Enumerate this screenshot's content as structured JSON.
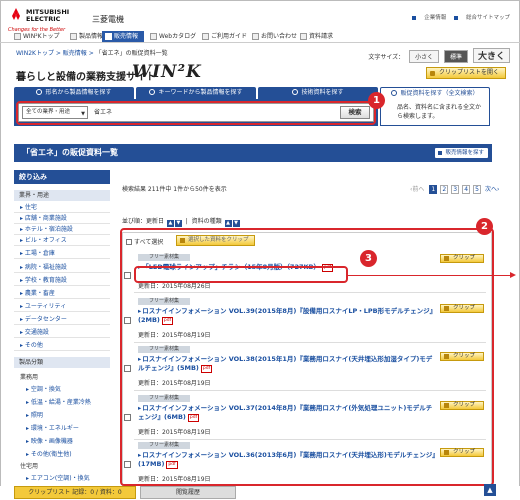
{
  "colors": {
    "primary": "#244f96",
    "annotation_red": "#d9262c",
    "clip_yellow": "#f3c93a",
    "link_blue": "#1a4fa0"
  },
  "header": {
    "logo_brand": "MITSUBISHI ELECTRIC",
    "logo_tagline": "Changes for the Better",
    "site_name": "三菱電機",
    "links": [
      "企業情報",
      "総合サイトマップ"
    ]
  },
  "nav": {
    "tabs": [
      "WIN²Kトップ",
      "製品情報",
      "販売情報",
      "Webカタログ",
      "ご利用ガイド",
      "お問い合わせ",
      "資料請求"
    ],
    "active": "販売情報"
  },
  "breadcrumb": [
    "WIN2Kトップ",
    "販売情報",
    "「省エネ」の販促資料一覧"
  ],
  "font_size": {
    "label": "文字サイズ：",
    "options": [
      "小さく",
      "標準",
      "大きく"
    ],
    "active": "標準"
  },
  "site_title": "暮らしと設備の業務支援サイト",
  "wink_logo": "WIN²K",
  "clip_list_open": "クリップリストを開く",
  "search": {
    "tabs": [
      "形名から製品情報を探す",
      "キーワードから製品情報を探す",
      "技術資料を探す",
      "販促資料を探す（全文検索）"
    ],
    "active_tab": "販促資料を探す（全文検索）",
    "category_select": "全ての業界・用途",
    "keyword": "省エネ",
    "button": "検索",
    "fulltext_note": "品名、資料名に含まれる全文から検索します。"
  },
  "annotations": [
    "1",
    "2",
    "3"
  ],
  "list_header": {
    "title": "「省エネ」の販促資料一覧",
    "sales_info_button": "販売情報を探す"
  },
  "sidebar": {
    "title": "絞り込み",
    "sections": [
      {
        "label": "業界・用途",
        "items": [
          "住宅",
          "店舗・商業施設",
          "ホテル・宿泊施設",
          "ビル・オフィス",
          "工場・倉庫",
          "病院・福祉施設",
          "学校・教育施設",
          "農業・畜産",
          "ユーティリティ",
          "データセンター",
          "交通施設",
          "その他"
        ]
      },
      {
        "label": "製品分類",
        "items": []
      }
    ],
    "subgroups": [
      {
        "label": "業務用",
        "items": [
          "空調・換気",
          "低温・給湯・産業冷熱",
          "照明",
          "環境・エネルギー",
          "映像・画像機器",
          "その他(衛生他)"
        ]
      },
      {
        "label": "住宅用",
        "items": [
          "エアコン(空調)・換気"
        ]
      }
    ]
  },
  "results": {
    "summary": "検索結果 211件中 1件から50件を表示",
    "pager": {
      "prev": "前へ",
      "pages": [
        "1",
        "2",
        "3",
        "4",
        "5"
      ],
      "active": "1",
      "next": "次へ"
    },
    "sort": {
      "label1": "並び順：更新日",
      "label2": "資料の種類"
    },
    "select_all": "すべて選択",
    "clip_selected": "選択した資料をクリップ",
    "items": [
      {
        "category": "フリー素材集",
        "title": "「LED電球ラインアップ」チラシ（15年8月版）（727KB）",
        "date": "更新日：2015年08月26日",
        "clip": "クリップ"
      },
      {
        "category": "フリー素材集",
        "title": "ロスナイインフォメーション VOL.39(2015年8月)『設備用ロスナイLP・LPB形モデルチェンジ』(2MB)",
        "date": "更新日：2015年08月19日",
        "clip": "クリップ"
      },
      {
        "category": "フリー素材集",
        "title": "ロスナイインフォメーション VOL.38(2015年1月)『業務用ロスナイ(天井埋込形加湿タイプ)モデルチェンジ』(5MB)",
        "date": "更新日：2015年08月19日",
        "clip": "クリップ"
      },
      {
        "category": "フリー素材集",
        "title": "ロスナイインフォメーション VOL.37(2014年8月)『業務用ロスナイ(外気処理ユニット)モデルチェンジ』(6MB)",
        "date": "更新日：2015年08月19日",
        "clip": "クリップ"
      },
      {
        "category": "フリー素材集",
        "title": "ロスナイインフォメーション VOL.36(2013年6月)『業務用ロスナイ(天井埋込形)モデルチェンジ』(17MB)",
        "date": "更新日：2015年08月19日",
        "clip": "クリップ"
      }
    ],
    "pdf_label": "pdf"
  },
  "bottom": {
    "clip_list": "クリップリスト 記録：0 / 資料：0",
    "history": "閲覧履歴",
    "clip": "クリップ"
  }
}
